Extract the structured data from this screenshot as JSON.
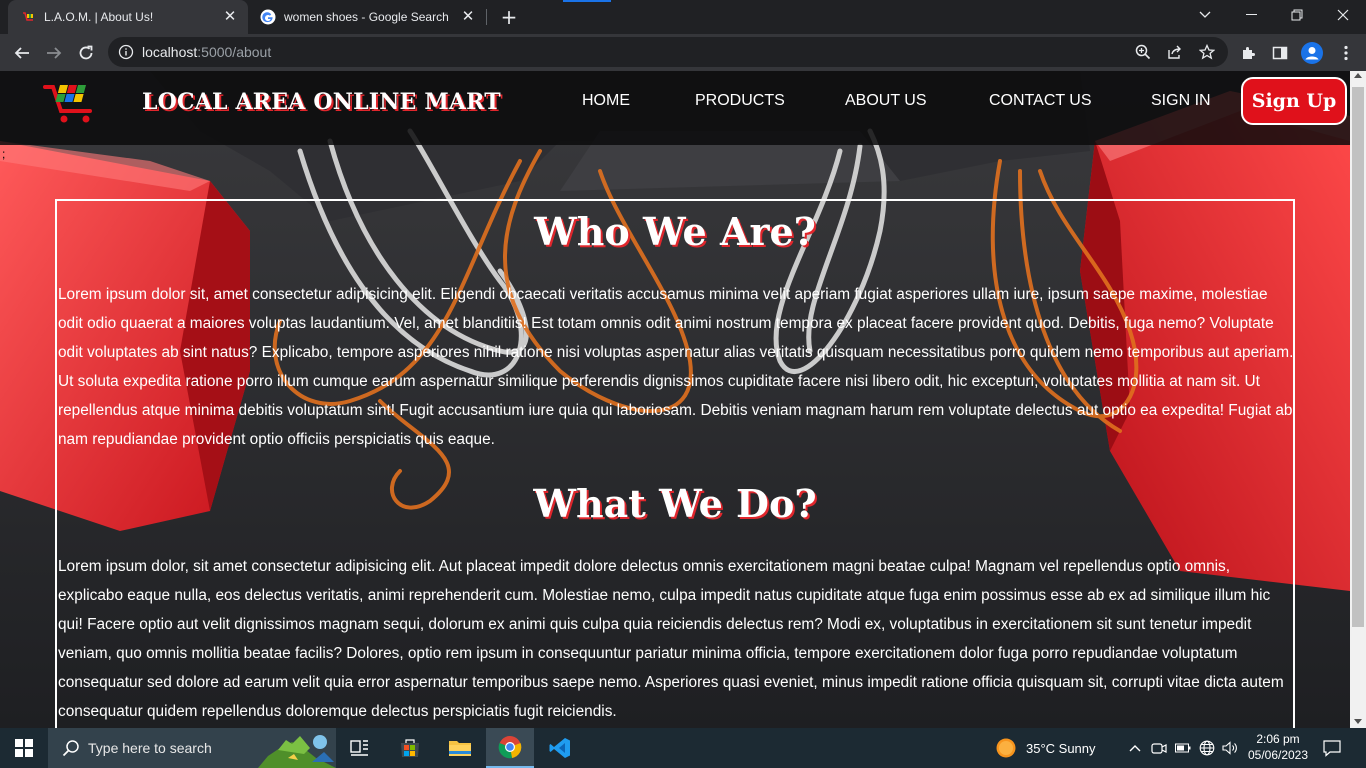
{
  "browser": {
    "tabs": [
      {
        "title": "L.A.O.M. | About Us!",
        "active": true
      },
      {
        "title": "women shoes - Google Search",
        "active": false
      }
    ],
    "url_host": "localhost",
    "url_path": ":5000/about"
  },
  "site": {
    "brand": "LOCAL AREA ONLINE MART",
    "nav": [
      "HOME",
      "PRODUCTS",
      "ABOUT US",
      "CONTACT US",
      "SIGN IN"
    ],
    "signup_label": "Sign Up",
    "stray_char": ";",
    "sections": [
      {
        "heading": "Who We Are?",
        "body": "Lorem ipsum dolor sit, amet consectetur adipisicing elit. Eligendi obcaecati veritatis accusamus minima velit aperiam fugiat asperiores ullam iure, ipsum saepe maxime, molestiae odit odio quaerat a maiores voluptas laudantium. Vel, amet blanditiis! Est totam omnis odit animi nostrum tempora ex placeat facere provident quod. Debitis, fuga nemo? Voluptate odit voluptates ab sint natus? Explicabo, tempore asperiores nihil ratione nisi voluptas aspernatur alias veritatis quisquam necessitatibus porro quidem nemo temporibus aut aperiam. Ut soluta expedita ratione porro illum cumque earum aspernatur similique perferendis dignissimos cupiditate facere nisi libero odit, hic excepturi, voluptates mollitia at nam sit. Ut repellendus atque minima debitis voluptatum sint! Fugit accusantium iure quia qui laboriosam. Debitis veniam magnam harum rem voluptate delectus aut optio ea expedita! Fugiat ab nam repudiandae provident optio officiis perspiciatis quis eaque."
      },
      {
        "heading": "What We Do?",
        "body": "Lorem ipsum dolor, sit amet consectetur adipisicing elit. Aut placeat impedit dolore delectus omnis exercitationem magni beatae culpa! Magnam vel repellendus optio omnis, explicabo eaque nulla, eos delectus veritatis, animi reprehenderit cum. Molestiae nemo, culpa impedit natus cupiditate atque fuga enim possimus esse ab ex ad similique illum hic qui! Facere optio aut velit dignissimos magnam sequi, dolorum ex animi quis culpa quia reiciendis delectus rem? Modi ex, voluptatibus in exercitationem sit sunt tenetur impedit veniam, quo omnis mollitia beatae facilis? Dolores, optio rem ipsum in consequuntur pariatur minima officia, tempore exercitationem dolor fuga porro repudiandae voluptatum consequatur sed dolore ad earum velit quia error aspernatur temporibus saepe nemo. Asperiores quasi eveniet, minus impedit ratione officia quisquam sit, corrupti vitae dicta autem consequatur quidem repellendus doloremque delectus perspiciatis fugit reiciendis."
      }
    ]
  },
  "taskbar": {
    "search_placeholder": "Type here to search",
    "weather": "35°C  Sunny",
    "time": "2:06 pm",
    "date": "05/06/2023"
  },
  "colors": {
    "accent_red": "#e0111b",
    "chrome_dark": "#202124",
    "chrome_toolbar": "#35363a"
  }
}
